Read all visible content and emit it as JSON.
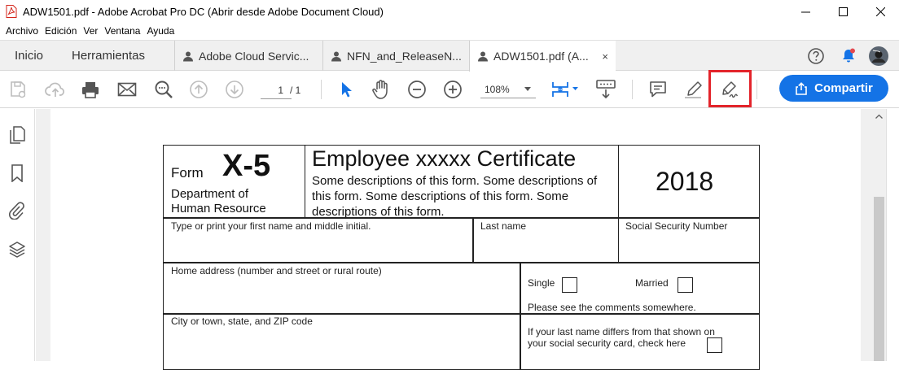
{
  "window": {
    "title": "ADW1501.pdf - Adobe Acrobat Pro DC (Abrir desde Adobe Document Cloud)"
  },
  "menu": [
    "Archivo",
    "Edición",
    "Ver",
    "Ventana",
    "Ayuda"
  ],
  "tabs": {
    "home": "Inicio",
    "tools": "Herramientas",
    "documents": [
      {
        "label": "Adobe Cloud Servic...",
        "active": false
      },
      {
        "label": "NFN_and_ReleaseN...",
        "active": false
      },
      {
        "label": "ADW1501.pdf (A...",
        "active": true
      }
    ],
    "close_glyph": "×"
  },
  "toolbar": {
    "page_current": "1",
    "page_total": "/ 1",
    "zoom": "108%",
    "share_label": "Compartir"
  },
  "colors": {
    "accent": "#1473e6",
    "highlight": "#e3242b",
    "notification": "#e34850"
  },
  "form": {
    "form_word": "Form",
    "form_number": "X-5",
    "department": "Department of\nHuman Resource",
    "title": "Employee xxxxx Certificate",
    "description": "Some descriptions of this form. Some descriptions of this form. Some descriptions of this form. Some descriptions of this form.",
    "year": "2018",
    "fields": {
      "first_name": "Type or print your first name and middle initial.",
      "last_name": "Last name",
      "ssn": "Social Security Number",
      "home_address": "Home address (number and street or rural route)",
      "single": "Single",
      "married": "Married",
      "comments_note": "Please see the comments somewhere.",
      "city": "City or town, state, and ZIP code",
      "last_name_differs": "If your last name differs from that shown on\nyour social security card, check here"
    }
  }
}
